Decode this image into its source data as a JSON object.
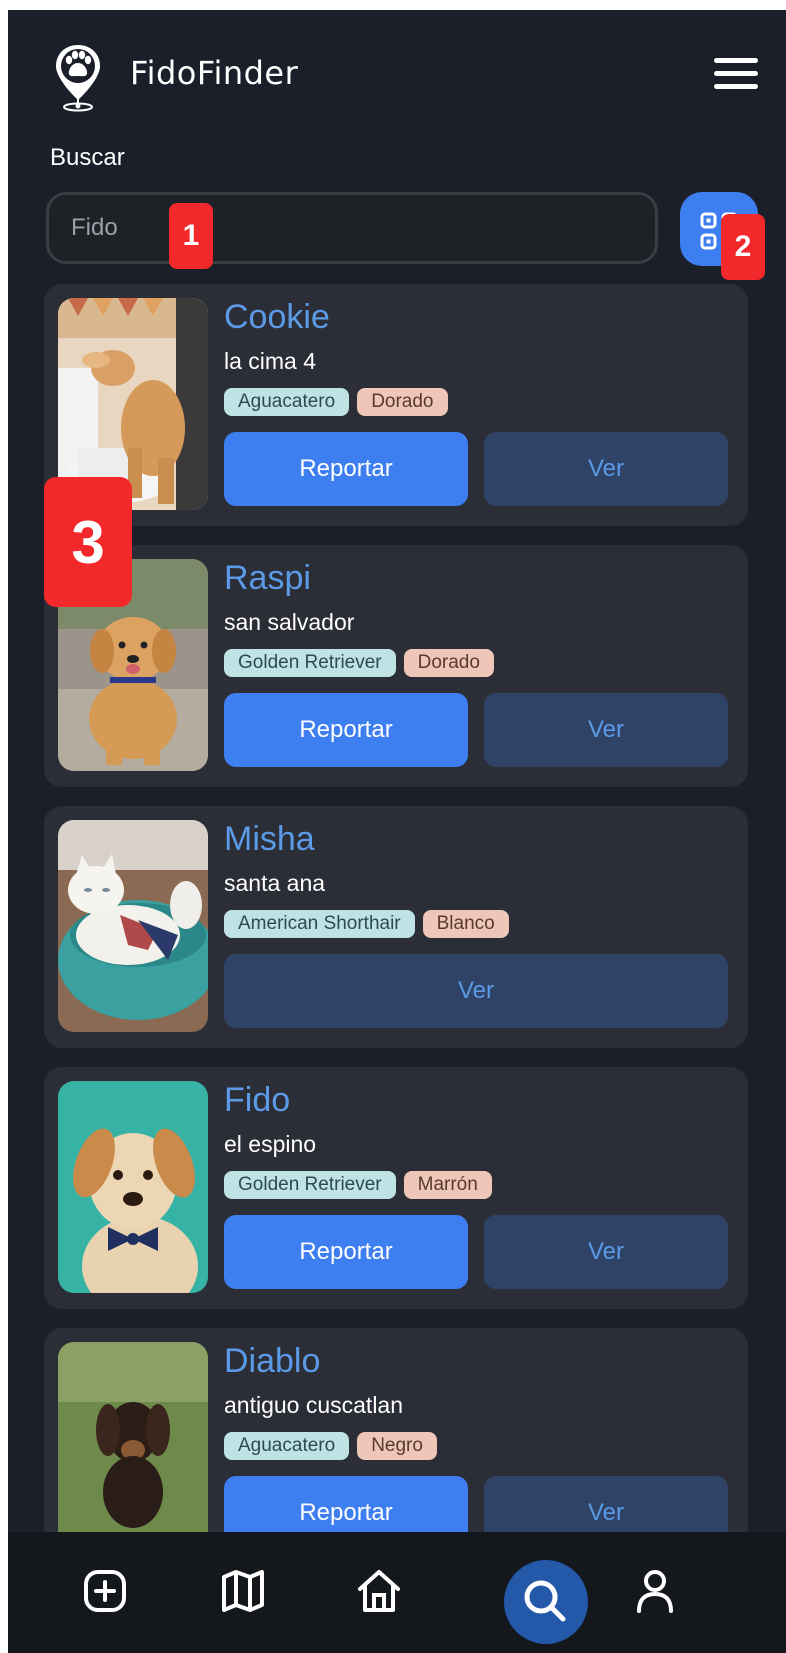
{
  "app": {
    "title": "FidoFinder"
  },
  "search": {
    "label": "Buscar",
    "placeholder": "Fido"
  },
  "annotations": [
    "1",
    "2",
    "3"
  ],
  "buttons": {
    "report": "Reportar",
    "view": "Ver"
  },
  "pets": [
    {
      "name": "Cookie",
      "location": "la cima 4",
      "breed": "Aguacatero",
      "color": "Dorado",
      "can_report": true
    },
    {
      "name": "Raspi",
      "location": "san salvador",
      "breed": "Golden Retriever",
      "color": "Dorado",
      "can_report": true
    },
    {
      "name": "Misha",
      "location": "santa ana",
      "breed": "American Shorthair",
      "color": "Blanco",
      "can_report": false
    },
    {
      "name": "Fido",
      "location": "el espino",
      "breed": "Golden Retriever",
      "color": "Marrón",
      "can_report": true
    },
    {
      "name": "Diablo",
      "location": "antiguo cuscatlan",
      "breed": "Aguacatero",
      "color": "Negro",
      "can_report": true
    }
  ],
  "nav": {
    "items": [
      "add-icon",
      "map-icon",
      "home-icon",
      "search-icon",
      "user-icon"
    ],
    "active": "search-icon"
  },
  "colors": {
    "background": "#1a1f2a",
    "card": "#2c2e37",
    "accent": "#3d7ef0",
    "name": "#5b9ae6",
    "view_button": "#2f4366",
    "annotation": "#f2282b"
  }
}
